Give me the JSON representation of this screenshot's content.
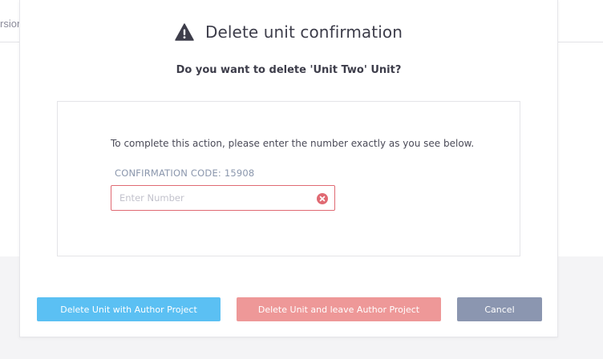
{
  "background": {
    "fragment_text": "rsion"
  },
  "modal": {
    "title": "Delete unit confirmation",
    "title_icon": "warning-triangle-icon",
    "question": "Do you want to delete 'Unit Two' Unit?",
    "instruction": "To complete this action, please enter the number exactly as you see below.",
    "confirmation_label": "CONFIRMATION CODE: 15908",
    "input": {
      "value": "",
      "placeholder": "Enter Number",
      "error_icon": "clear-x-icon"
    },
    "buttons": {
      "delete_with_author": "Delete Unit with Author Project",
      "delete_leave_author": "Delete Unit and leave Author Project",
      "cancel": "Cancel"
    }
  },
  "colors": {
    "primary_button": "#5bc0f3",
    "danger_button": "#ee9898",
    "cancel_button": "#8b96b0",
    "error_border": "#e06a73",
    "title_text": "#3d3d4a",
    "code_label": "#8b97ad"
  }
}
